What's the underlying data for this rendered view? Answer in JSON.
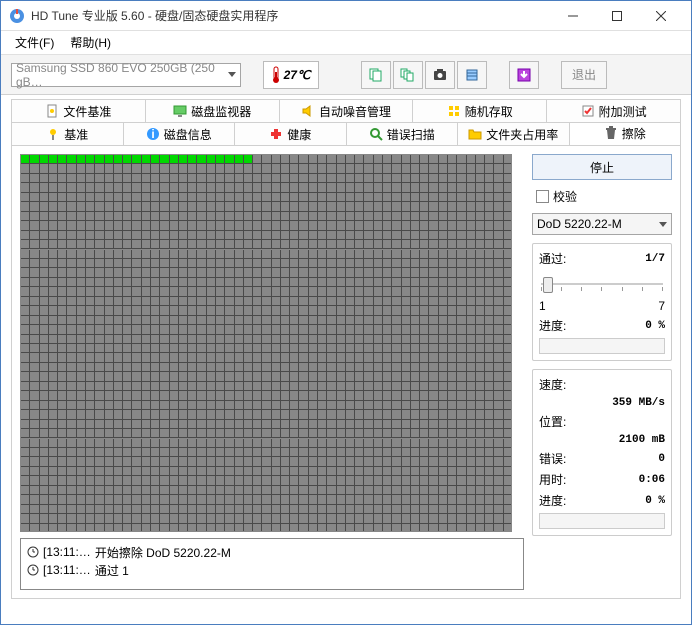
{
  "window": {
    "title": "HD Tune 专业版 5.60 - 硬盘/固态硬盘实用程序"
  },
  "menu": {
    "file": "文件(F)",
    "help": "帮助(H)"
  },
  "toolbar": {
    "drive": "Samsung SSD 860 EVO 250GB (250 gB…",
    "temperature": "27℃",
    "exit": "退出"
  },
  "tabs_row1": {
    "t1": "文件基准",
    "t2": "磁盘监视器",
    "t3": "自动噪音管理",
    "t4": "随机存取",
    "t5": "附加测试"
  },
  "tabs_row2": {
    "t1": "基准",
    "t2": "磁盘信息",
    "t3": "健康",
    "t4": "错误扫描",
    "t5": "文件夹占用率",
    "t6": "擦除"
  },
  "controls": {
    "stop": "停止",
    "verify": "校验",
    "method": "DoD 5220.22-M"
  },
  "pass_panel": {
    "label": "通过:",
    "value": "1/7",
    "scale_min": "1",
    "scale_max": "7",
    "progress_label": "进度:",
    "progress_value": "0 %"
  },
  "stats_panel": {
    "speed_label": "速度:",
    "speed_value": "359 MB/s",
    "position_label": "位置:",
    "position_value": "2100 mB",
    "errors_label": "错误:",
    "errors_value": "0",
    "time_label": "用时:",
    "time_value": "0:06",
    "progress_label": "进度:",
    "progress_value": "0 %"
  },
  "log": {
    "line1_time": "[13:11:…",
    "line1_text": "开始擦除 DoD 5220.22-M",
    "line2_time": "[13:11:…",
    "line2_text": "通过 1"
  },
  "grid": {
    "cols": 53,
    "rows": 40,
    "done_cells": 25
  }
}
